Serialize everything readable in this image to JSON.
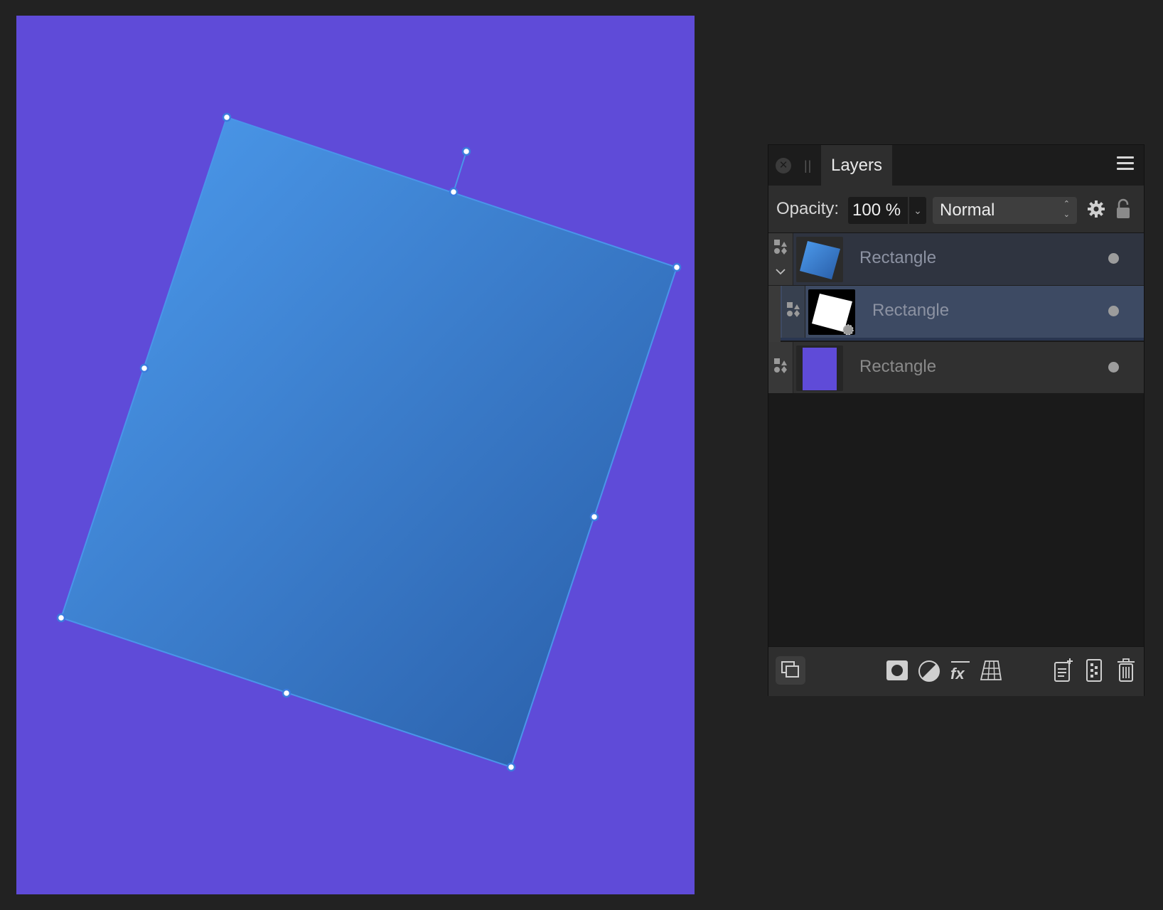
{
  "layers_panel": {
    "tab_title": "Layers",
    "opacity_label": "Opacity:",
    "opacity_value": "100 %",
    "blend_mode": "Normal",
    "layers": [
      {
        "name": "Rectangle",
        "visible": true,
        "type": "gradient-shape",
        "expanded": true
      },
      {
        "name": "Rectangle",
        "visible": true,
        "type": "mask",
        "selected": true,
        "child": true
      },
      {
        "name": "Rectangle",
        "visible": true,
        "type": "solid"
      }
    ]
  },
  "icons": {
    "panel": [
      "close-icon",
      "grip-icon",
      "hamburger-menu-icon",
      "chevron-down-icon",
      "gear-icon",
      "lock-icon"
    ],
    "footer": [
      "arrange-icon",
      "mask-icon",
      "adjustment-icon",
      "fx-icon",
      "live-filter-icon",
      "add-layer-icon",
      "add-pixel-layer-icon",
      "trash-icon"
    ]
  },
  "colors": {
    "canvas": "#5f4bd8",
    "shape_gradient_start": "#4d9cee",
    "shape_gradient_end": "#285ca6",
    "selection_handle": "#ffffff",
    "selected_row": "#3d4a63"
  }
}
